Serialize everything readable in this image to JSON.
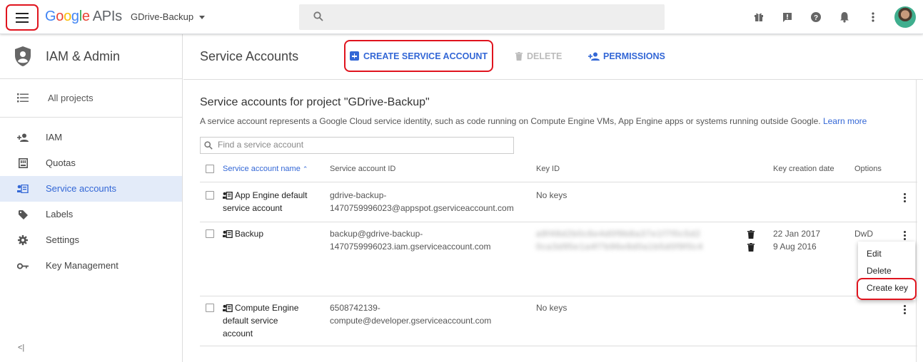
{
  "header": {
    "logo_letters": [
      "G",
      "o",
      "o",
      "g",
      "l",
      "e"
    ],
    "logo_suffix": "APIs",
    "project_name": "GDrive-Backup",
    "icons": [
      "gift-icon",
      "feedback-icon",
      "help-icon",
      "notifications-icon",
      "more-vert-icon"
    ]
  },
  "sidebar": {
    "title": "IAM & Admin",
    "all_projects": "All projects",
    "items": [
      {
        "label": "IAM",
        "icon": "person-add-icon"
      },
      {
        "label": "Quotas",
        "icon": "quota-icon"
      },
      {
        "label": "Service accounts",
        "icon": "service-account-icon",
        "active": true
      },
      {
        "label": "Labels",
        "icon": "label-icon"
      },
      {
        "label": "Settings",
        "icon": "gear-icon"
      },
      {
        "label": "Key Management",
        "icon": "key-icon"
      }
    ],
    "collapse": "<|"
  },
  "toolbar": {
    "title": "Service Accounts",
    "create": "CREATE SERVICE ACCOUNT",
    "delete": "DELETE",
    "permissions": "PERMISSIONS"
  },
  "content": {
    "heading": "Service accounts for project \"GDrive-Backup\"",
    "description": "A service account represents a Google Cloud service identity, such as code running on Compute Engine VMs, App Engine apps or systems running outside Google.",
    "learn_more": "Learn more",
    "search_placeholder": "Find a service account"
  },
  "table": {
    "headers": {
      "name": "Service account name",
      "id": "Service account ID",
      "key_id": "Key ID",
      "key_date": "Key creation date",
      "options": "Options"
    },
    "rows": [
      {
        "name_l1": "App Engine default",
        "name_l2": "service account",
        "id_l1": "gdrive-backup-",
        "id_l2": "1470759996023@appspot.gserviceaccount.com",
        "key": "No keys"
      },
      {
        "name_l1": "Backup",
        "id_l1": "backup@gdrive-backup-",
        "id_l2": "1470759996023.iam.gserviceaccount.com",
        "key_blur_1": "a9f48d2b0c6e4d0f9b8a37e1f7f0c5d2",
        "key_blur_2": "0ca3d95e1a4f7b96e8d0a1b5d0f9f0c4",
        "date_1": "22 Jan 2017",
        "date_2": "9 Aug 2016",
        "option": "DwD"
      },
      {
        "name_l1": "Compute Engine",
        "name_l2": "default service",
        "name_l3": "account",
        "id_l1": "6508742139-",
        "id_l2": "compute@developer.gserviceaccount.com",
        "key": "No keys"
      }
    ]
  },
  "context_menu": {
    "items": [
      "Edit",
      "Delete",
      "Create key"
    ]
  },
  "colors": {
    "accent": "#3367d6",
    "highlight": "#e0141e",
    "active_nav_bg": "#e3ebf9"
  }
}
